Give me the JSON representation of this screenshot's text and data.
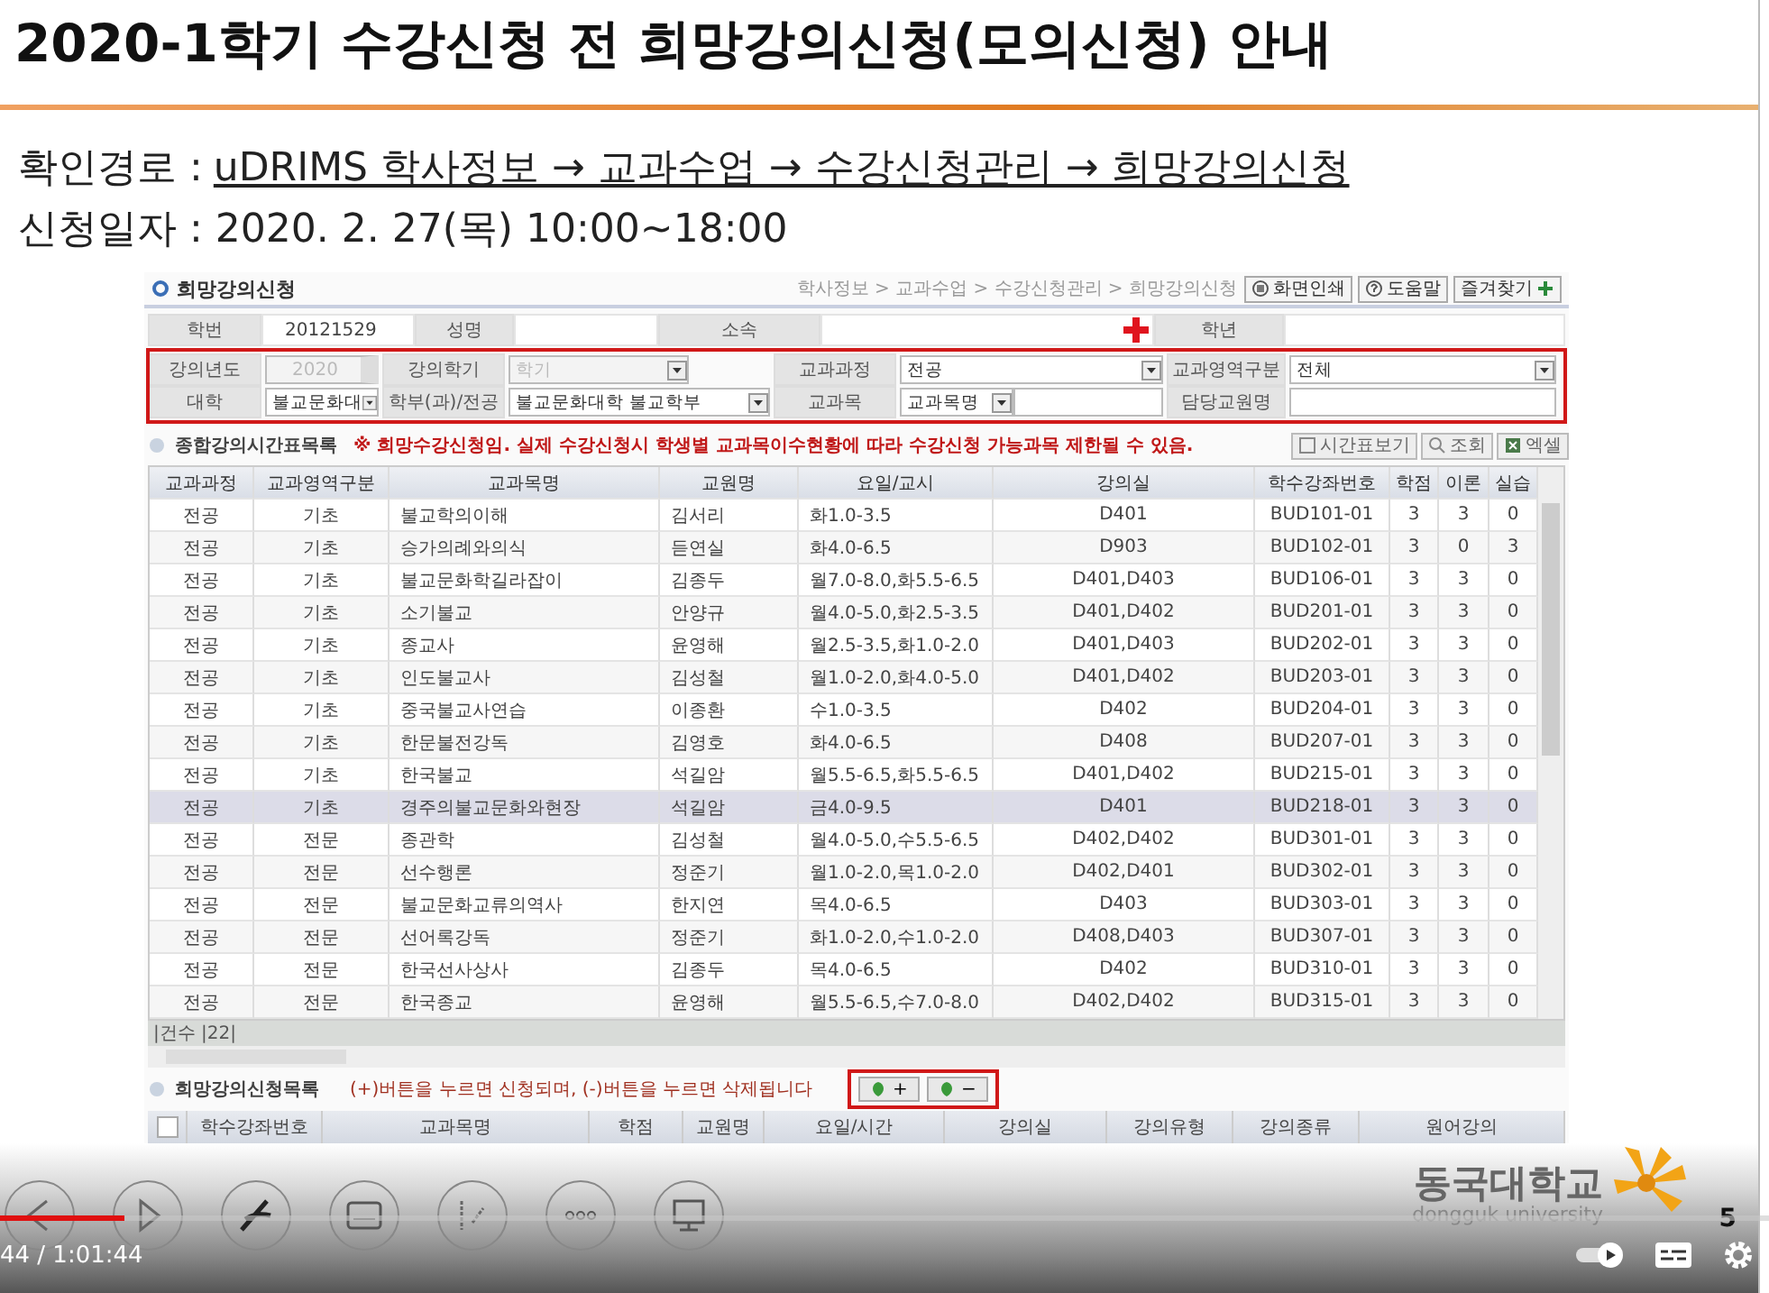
{
  "slide": {
    "title": "2020-1학기 수강신청 전 희망강의신청(모의신청) 안내",
    "path_label": "확인경로 :",
    "path": "uDRIMS 학사정보 → 교과수업 → 수강신청관리 → 희망강의신청",
    "date": "신청일자 : 2020. 2. 27(목) 10:00~18:00",
    "logo_name": "동국대학교",
    "logo_sub": "dongguk university",
    "page": "5"
  },
  "app": {
    "title": "희망강의신청",
    "breadcrumb": "학사정보 > 교과수업 > 수강신청관리 > 희망강의신청",
    "toolbar": [
      {
        "kind": "print",
        "label": "화면인쇄"
      },
      {
        "kind": "help",
        "label": "도움말"
      },
      {
        "kind": "favorite",
        "label": "즐겨찾기"
      }
    ],
    "info": [
      {
        "label": "학번",
        "value": "20121529"
      },
      {
        "label": "성명"
      },
      {
        "label": "소속"
      },
      {
        "label": "학년"
      }
    ],
    "filters": [
      [
        {
          "label": "강의년도",
          "kind": "spinner",
          "value": "2020",
          "disabled": true
        },
        {
          "label": "강의학기",
          "kind": "select",
          "value": "학기",
          "disabled": true
        },
        {
          "label": "교과과정",
          "kind": "select",
          "value": "전공",
          "disabled": false
        },
        {
          "label": "교과영역구분",
          "kind": "select",
          "value": "전체",
          "disabled": false
        }
      ],
      [
        {
          "label": "대학",
          "kind": "select",
          "value": "불교문화대",
          "disabled": false
        },
        {
          "label": "학부(과)/전공",
          "kind": "select",
          "value": "불교문화대학 불교학부",
          "disabled": false
        },
        {
          "label": "교과목",
          "kind": "select_input",
          "value": "교과목명",
          "disabled": false
        },
        {
          "label": "담당교원명",
          "kind": "input",
          "disabled": false
        }
      ]
    ],
    "list_title": "종합강의시간표목록",
    "notice": "※ 희망수강신청임. 실제 수강신청시 학생별 교과목이수현황에 따라 수강신청 가능과목 제한될 수 있음.",
    "list_buttons": [
      {
        "kind": "timetable",
        "label": "시간표보기"
      },
      {
        "kind": "search",
        "label": "조회"
      },
      {
        "kind": "excel",
        "label": "엑셀"
      }
    ],
    "columns": [
      "교과과정",
      "교과영역구분",
      "교과목명",
      "교원명",
      "요일/교시",
      "강의실",
      "학수강좌번호",
      "학점",
      "이론",
      "실습"
    ],
    "rows": [
      {
        "cells": [
          "전공",
          "기초",
          "불교학의이해",
          "김서리",
          "화1.0-3.5",
          "D401",
          "BUD101-01",
          "3",
          "3",
          "0"
        ],
        "selected": false
      },
      {
        "cells": [
          "전공",
          "기초",
          "승가의례와의식",
          "듣연실",
          "화4.0-6.5",
          "D903",
          "BUD102-01",
          "3",
          "0",
          "3"
        ],
        "selected": false
      },
      {
        "cells": [
          "전공",
          "기초",
          "불교문화학길라잡이",
          "김종두",
          "월7.0-8.0,화5.5-6.5",
          "D401,D403",
          "BUD106-01",
          "3",
          "3",
          "0"
        ],
        "selected": false
      },
      {
        "cells": [
          "전공",
          "기초",
          "소기불교",
          "안양규",
          "월4.0-5.0,화2.5-3.5",
          "D401,D402",
          "BUD201-01",
          "3",
          "3",
          "0"
        ],
        "selected": false
      },
      {
        "cells": [
          "전공",
          "기초",
          "종교사",
          "윤영해",
          "월2.5-3.5,화1.0-2.0",
          "D401,D403",
          "BUD202-01",
          "3",
          "3",
          "0"
        ],
        "selected": false
      },
      {
        "cells": [
          "전공",
          "기초",
          "인도불교사",
          "김성철",
          "월1.0-2.0,화4.0-5.0",
          "D401,D402",
          "BUD203-01",
          "3",
          "3",
          "0"
        ],
        "selected": false
      },
      {
        "cells": [
          "전공",
          "기초",
          "중국불교사연습",
          "이종환",
          "수1.0-3.5",
          "D402",
          "BUD204-01",
          "3",
          "3",
          "0"
        ],
        "selected": false
      },
      {
        "cells": [
          "전공",
          "기초",
          "한문불전강독",
          "김영호",
          "화4.0-6.5",
          "D408",
          "BUD207-01",
          "3",
          "3",
          "0"
        ],
        "selected": false
      },
      {
        "cells": [
          "전공",
          "기초",
          "한국불교",
          "석길암",
          "월5.5-6.5,화5.5-6.5",
          "D401,D402",
          "BUD215-01",
          "3",
          "3",
          "0"
        ],
        "selected": false
      },
      {
        "cells": [
          "전공",
          "기초",
          "경주의불교문화와현장",
          "석길암",
          "금4.0-9.5",
          "D401",
          "BUD218-01",
          "3",
          "3",
          "0"
        ],
        "selected": true
      },
      {
        "cells": [
          "전공",
          "전문",
          "종관학",
          "김성철",
          "월4.0-5.0,수5.5-6.5",
          "D402,D402",
          "BUD301-01",
          "3",
          "3",
          "0"
        ],
        "selected": false
      },
      {
        "cells": [
          "전공",
          "전문",
          "선수행론",
          "정준기",
          "월1.0-2.0,목1.0-2.0",
          "D402,D401",
          "BUD302-01",
          "3",
          "3",
          "0"
        ],
        "selected": false
      },
      {
        "cells": [
          "전공",
          "전문",
          "불교문화교류의역사",
          "한지연",
          "목4.0-6.5",
          "D403",
          "BUD303-01",
          "3",
          "3",
          "0"
        ],
        "selected": false
      },
      {
        "cells": [
          "전공",
          "전문",
          "선어록강독",
          "정준기",
          "화1.0-2.0,수1.0-2.0",
          "D408,D403",
          "BUD307-01",
          "3",
          "3",
          "0"
        ],
        "selected": false
      },
      {
        "cells": [
          "전공",
          "전문",
          "한국선사상사",
          "김종두",
          "목4.0-6.5",
          "D402",
          "BUD310-01",
          "3",
          "3",
          "0"
        ],
        "selected": false
      },
      {
        "cells": [
          "전공",
          "전문",
          "한국종교",
          "윤영해",
          "월5.5-6.5,수7.0-8.0",
          "D402,D402",
          "BUD315-01",
          "3",
          "3",
          "0"
        ],
        "selected": false
      }
    ],
    "count": "|건수 |22|",
    "wish_title": "희망강의신청목록",
    "wish_note": "(+)버튼을 누르면 신청되며, (-)버튼을 누르면 삭제됩니다",
    "wish_buttons": [
      "+",
      "−"
    ],
    "wish_select_all": {
      "checked": false
    },
    "wish_columns": [
      "학수강좌번호",
      "교과목명",
      "학점",
      "교원명",
      "요일/시간",
      "강의실",
      "강의유형",
      "강의종류",
      "원어강의"
    ]
  },
  "player": {
    "time": "44 / 1:01:44",
    "progress": {
      "level": 0.07
    }
  }
}
